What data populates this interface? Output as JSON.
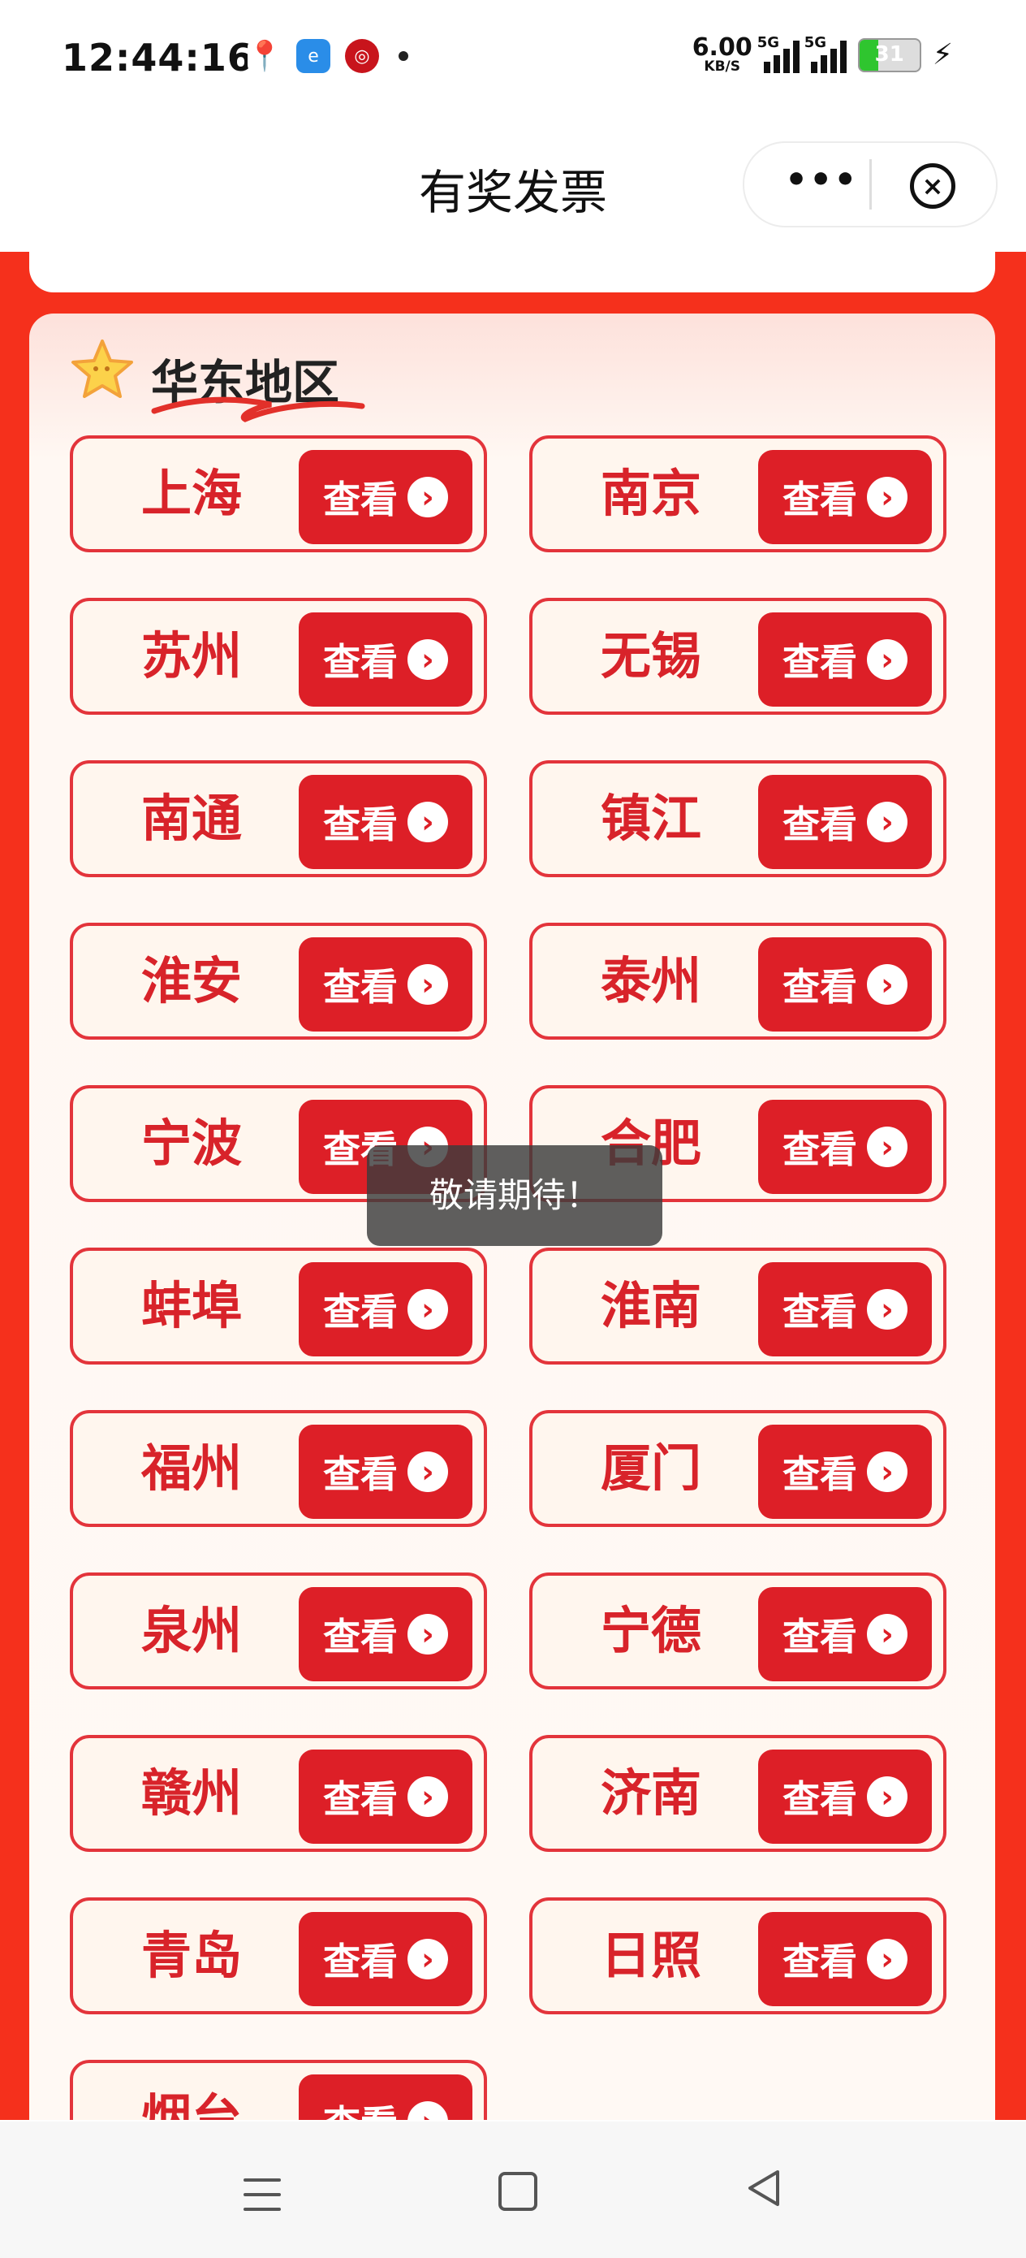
{
  "status_bar": {
    "time": "12:44:16",
    "app_icons": [
      "map-pin-icon",
      "e-app-icon",
      "bank-icon"
    ],
    "net_speed_value": "6.00",
    "net_speed_unit": "KB/S",
    "signal1_label": "5G",
    "signal2_label": "5G",
    "battery_percent": "31"
  },
  "header": {
    "title": "有奖发票",
    "more_icon": "more-dots-icon",
    "close_icon": "close-circle-icon"
  },
  "section": {
    "title": "华东地区",
    "icon": "star-icon"
  },
  "button_label": "查看",
  "cities": [
    "上海",
    "南京",
    "苏州",
    "无锡",
    "南通",
    "镇江",
    "淮安",
    "泰州",
    "宁波",
    "合肥",
    "蚌埠",
    "淮南",
    "福州",
    "厦门",
    "泉州",
    "宁德",
    "赣州",
    "济南",
    "青岛",
    "日照",
    "烟台"
  ],
  "toast": "敬请期待！",
  "nav": {
    "menu_icon": "menu-icon",
    "home_icon": "home-square-icon",
    "back_icon": "back-triangle-icon"
  },
  "colors": {
    "page_red": "#f5301c",
    "button_red": "#dd1f27",
    "city_text": "#d8232a"
  }
}
